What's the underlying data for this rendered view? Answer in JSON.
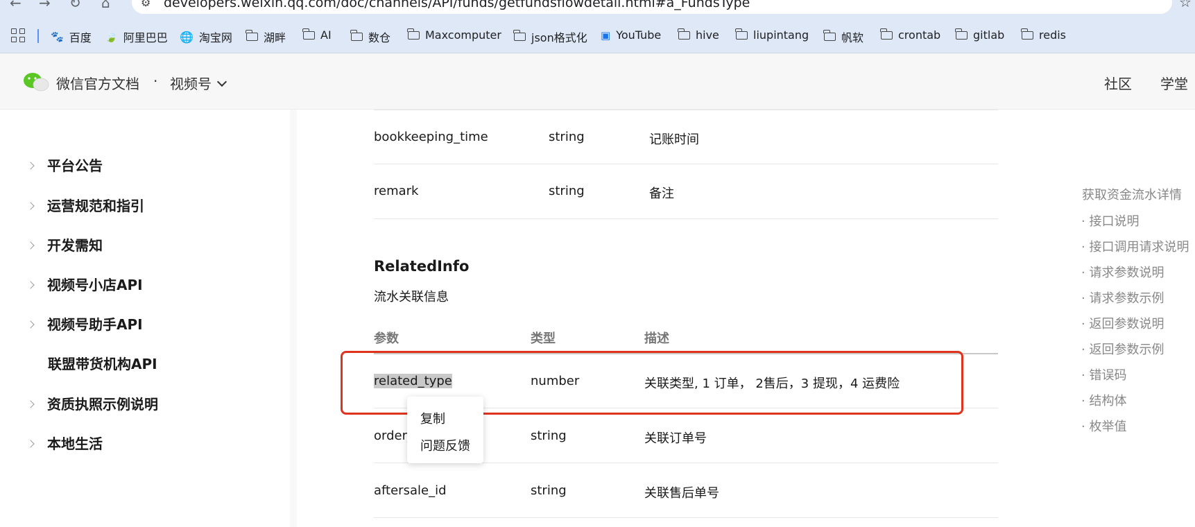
{
  "browser": {
    "url": "developers.weixin.qq.com/doc/channels/API/funds/getfundsflowdetail.html#a_FundsType",
    "bookmarks": [
      "百度",
      "阿里巴巴",
      "淘宝网",
      "湖畔",
      "AI",
      "数仓",
      "Maxcomputer",
      "json格式化",
      "YouTube",
      "hive",
      "liupintang",
      "帆软",
      "crontab",
      "gitlab",
      "redis"
    ]
  },
  "header": {
    "brand": "微信官方文档",
    "dot": "·",
    "section": "视频号",
    "links": [
      "社区",
      "学堂"
    ]
  },
  "sidebar": {
    "items": [
      {
        "label": "平台公告",
        "has_arrow": true
      },
      {
        "label": "运营规范和指引",
        "has_arrow": true
      },
      {
        "label": "开发需知",
        "has_arrow": true
      },
      {
        "label": "视频号小店API",
        "has_arrow": true
      },
      {
        "label": "视频号助手API",
        "has_arrow": true
      },
      {
        "label": "联盟带货机构API",
        "has_arrow": false
      },
      {
        "label": "资质执照示例说明",
        "has_arrow": true
      },
      {
        "label": "本地生活",
        "has_arrow": true
      }
    ]
  },
  "top_table": {
    "rows": [
      {
        "param": "bookkeeping_time",
        "type": "string",
        "desc": "记账时间"
      },
      {
        "param": "remark",
        "type": "string",
        "desc": "备注"
      }
    ]
  },
  "related_info": {
    "title": "RelatedInfo",
    "subtitle": "流水关联信息",
    "headers": {
      "param": "参数",
      "type": "类型",
      "desc": "描述"
    },
    "rows": [
      {
        "param": "related_type",
        "type": "number",
        "desc": "关联类型, 1 订单， 2售后，3 提现，4 运费险"
      },
      {
        "param": "order_",
        "type": "string",
        "desc": "关联订单号"
      },
      {
        "param": "aftersale_id",
        "type": "string",
        "desc": "关联售后单号"
      }
    ]
  },
  "context_menu": {
    "items": [
      "复制",
      "问题反馈"
    ]
  },
  "toc": {
    "title": "获取资金流水详情",
    "items": [
      "· 接口说明",
      "· 接口调用请求说明",
      "· 请求参数说明",
      "· 请求参数示例",
      "· 返回参数说明",
      "· 返回参数示例",
      "· 错误码",
      "· 结构体",
      "· 枚举值"
    ]
  },
  "colors": {
    "highlight_box": "#e0331c",
    "wechat_green": "#5ac725"
  }
}
